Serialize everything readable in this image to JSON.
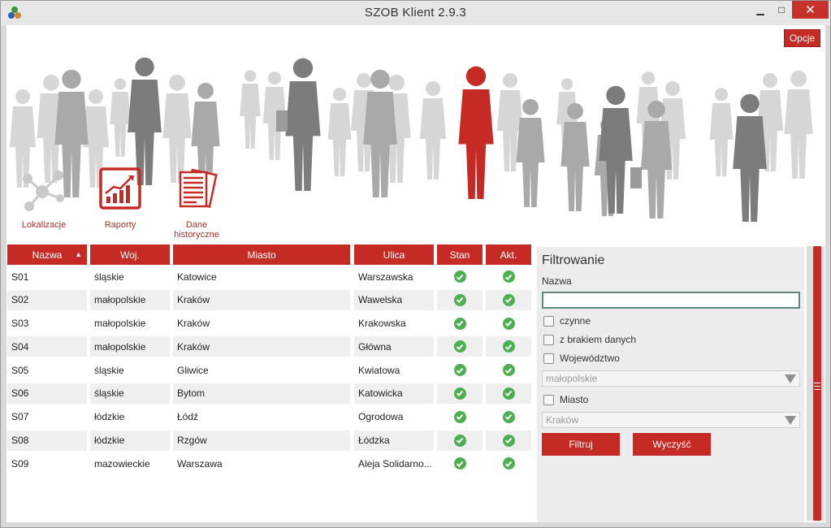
{
  "window": {
    "title": "SZOB Klient  2.9.3",
    "min_glyph": "▁",
    "max_glyph": "□",
    "close_glyph": "✕"
  },
  "header": {
    "options_label": "Opcje"
  },
  "nav": {
    "lokalizacje": "Lokalizacje",
    "raporty": "Raporty",
    "dane_line1": "Dane",
    "dane_line2": "historyczne"
  },
  "table": {
    "columns": [
      "Nazwa",
      "Woj.",
      "Miasto",
      "Ulica",
      "Stan",
      "Akt."
    ],
    "sort_glyph": "▲",
    "rows": [
      {
        "nazwa": "S01",
        "woj": "śląskie",
        "miasto": "Katowice",
        "ulica": "Warszawska"
      },
      {
        "nazwa": "S02",
        "woj": "małopolskie",
        "miasto": "Kraków",
        "ulica": "Wawelska"
      },
      {
        "nazwa": "S03",
        "woj": "małopolskie",
        "miasto": "Kraków",
        "ulica": "Krakowska"
      },
      {
        "nazwa": "S04",
        "woj": "małopolskie",
        "miasto": "Kraków",
        "ulica": "Główna"
      },
      {
        "nazwa": "S05",
        "woj": "śląskie",
        "miasto": "Gliwice",
        "ulica": "Kwiatowa"
      },
      {
        "nazwa": "S06",
        "woj": "śląskie",
        "miasto": "Bytom",
        "ulica": "Katowicka"
      },
      {
        "nazwa": "S07",
        "woj": "łódzkie",
        "miasto": "Łódź",
        "ulica": "Ogrodowa"
      },
      {
        "nazwa": "S08",
        "woj": "łódzkie",
        "miasto": "Rzgów",
        "ulica": "Łódzka"
      },
      {
        "nazwa": "S09",
        "woj": "mazowieckie",
        "miasto": "Warszawa",
        "ulica": "Aleja Solidarno..."
      }
    ]
  },
  "filter": {
    "title": "Filtrowanie",
    "name_label": "Nazwa",
    "name_value": "",
    "cb_czynne": "czynne",
    "cb_braki": "z brakiem danych",
    "cb_woj": "Województwo",
    "woj_selected": "małopolskie",
    "cb_miasto": "Miasto",
    "miasto_selected": "Kraków",
    "btn_filtruj": "Filtruj",
    "btn_wyczysc": "Wyczyść"
  },
  "colors": {
    "accent": "#c62a25",
    "check_green": "#4caf50",
    "silhouette_gray": "#c8c8c8",
    "silhouette_dark": "#7a7a7a"
  }
}
